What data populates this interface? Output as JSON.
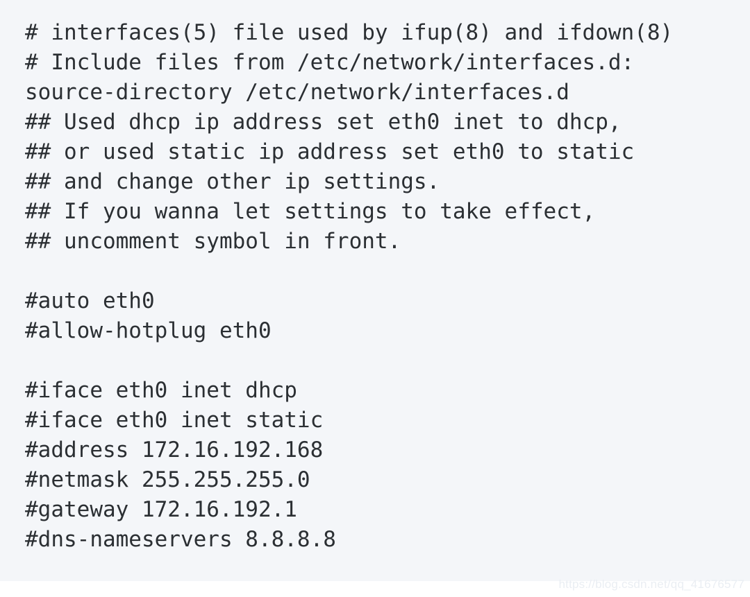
{
  "code_block": {
    "background_color": "#f4f6f9",
    "text_color": "#2b2f33",
    "lines": [
      {
        "text": "# interfaces(5) file used by ifup(8) and ifdown(8)"
      },
      {
        "text": "# Include files from /etc/network/interfaces.d:"
      },
      {
        "text": "source-directory /etc/network/interfaces.d"
      },
      {
        "text": "## Used dhcp ip address set eth0 inet to dhcp,"
      },
      {
        "text": "## or used static ip address set eth0 to static"
      },
      {
        "text": "## and change other ip settings."
      },
      {
        "text": "## If you wanna let settings to take effect,"
      },
      {
        "text": "## uncomment symbol in front."
      },
      {
        "text": ""
      },
      {
        "text": "#auto eth0"
      },
      {
        "text": "#allow-hotplug eth0"
      },
      {
        "text": ""
      },
      {
        "text": "#iface eth0 inet dhcp"
      },
      {
        "text": "#iface eth0 inet static"
      },
      {
        "text": "#address 172.16.192.168"
      },
      {
        "text": "#netmask 255.255.255.0"
      },
      {
        "text": "#gateway 172.16.192.1"
      },
      {
        "text": "#dns-nameservers 8.8.8.8"
      }
    ]
  },
  "watermark": {
    "text": "https://blog.csdn.net/qq_41676577",
    "color": "#eaeef3"
  }
}
